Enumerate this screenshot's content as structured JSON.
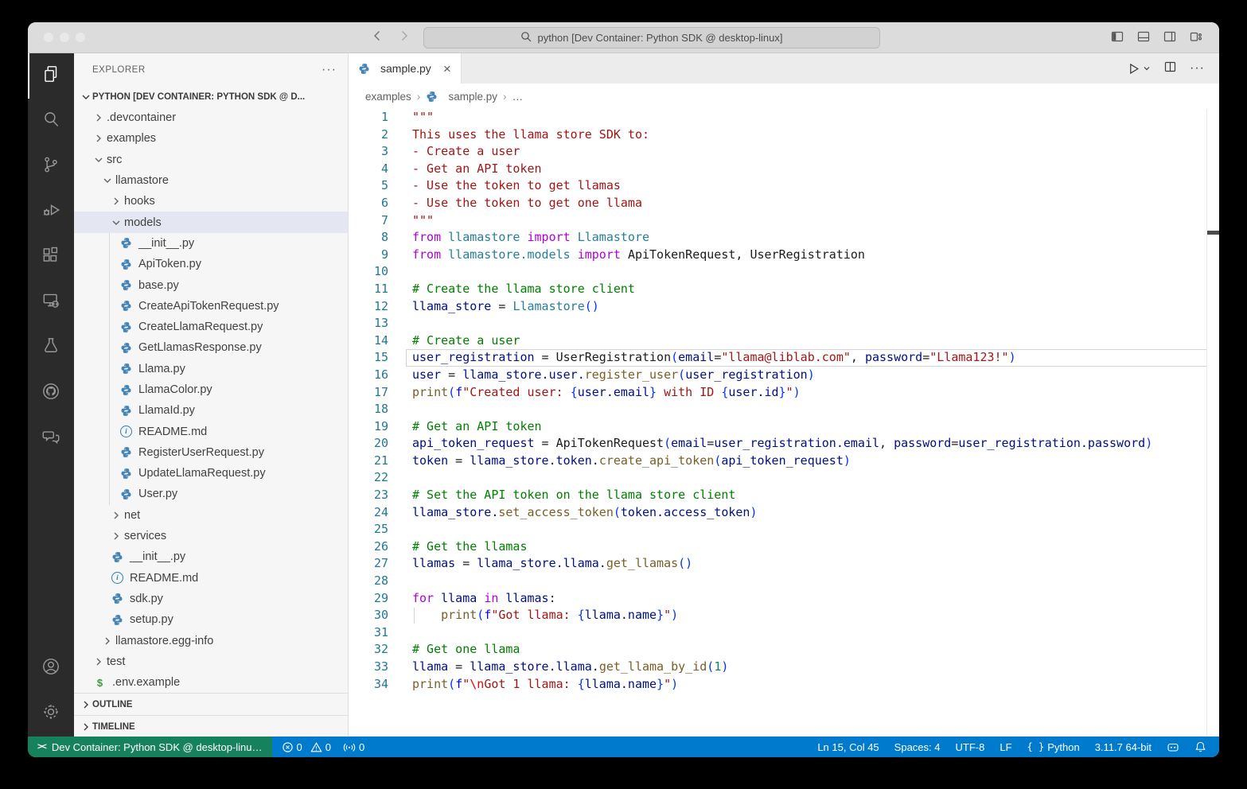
{
  "title_bar": {
    "command_center": "python [Dev Container: Python SDK @ desktop-linux]"
  },
  "activity_bar": {
    "items": [
      "explorer",
      "search",
      "source-control",
      "run-debug",
      "extensions",
      "remote-explorer",
      "testing",
      "github",
      "comments"
    ],
    "bottom": [
      "accounts",
      "settings"
    ]
  },
  "sidebar": {
    "header": "EXPLORER",
    "root_label": "PYTHON [DEV CONTAINER: PYTHON SDK @ D...",
    "tree": [
      {
        "label": ".devcontainer",
        "level": 1,
        "kind": "folder"
      },
      {
        "label": "examples",
        "level": 1,
        "kind": "folder"
      },
      {
        "label": "src",
        "level": 1,
        "kind": "folder",
        "expanded": true
      },
      {
        "label": "llamastore",
        "level": 2,
        "kind": "folder",
        "expanded": true
      },
      {
        "label": "hooks",
        "level": 3,
        "kind": "folder"
      },
      {
        "label": "models",
        "level": 3,
        "kind": "folder",
        "expanded": true,
        "selected": true
      },
      {
        "label": "__init__.py",
        "level": 4,
        "kind": "file",
        "icon": "python",
        "guide": true
      },
      {
        "label": "ApiToken.py",
        "level": 4,
        "kind": "file",
        "icon": "python",
        "guide": true
      },
      {
        "label": "base.py",
        "level": 4,
        "kind": "file",
        "icon": "python",
        "guide": true
      },
      {
        "label": "CreateApiTokenRequest.py",
        "level": 4,
        "kind": "file",
        "icon": "python",
        "guide": true
      },
      {
        "label": "CreateLlamaRequest.py",
        "level": 4,
        "kind": "file",
        "icon": "python",
        "guide": true
      },
      {
        "label": "GetLlamasResponse.py",
        "level": 4,
        "kind": "file",
        "icon": "python",
        "guide": true
      },
      {
        "label": "Llama.py",
        "level": 4,
        "kind": "file",
        "icon": "python",
        "guide": true
      },
      {
        "label": "LlamaColor.py",
        "level": 4,
        "kind": "file",
        "icon": "python",
        "guide": true
      },
      {
        "label": "LlamaId.py",
        "level": 4,
        "kind": "file",
        "icon": "python",
        "guide": true
      },
      {
        "label": "README.md",
        "level": 4,
        "kind": "file",
        "icon": "info",
        "guide": true
      },
      {
        "label": "RegisterUserRequest.py",
        "level": 4,
        "kind": "file",
        "icon": "python",
        "guide": true
      },
      {
        "label": "UpdateLlamaRequest.py",
        "level": 4,
        "kind": "file",
        "icon": "python",
        "guide": true
      },
      {
        "label": "User.py",
        "level": 4,
        "kind": "file",
        "icon": "python",
        "guide": true
      },
      {
        "label": "net",
        "level": 3,
        "kind": "folder"
      },
      {
        "label": "services",
        "level": 3,
        "kind": "folder"
      },
      {
        "label": "__init__.py",
        "level": 3,
        "kind": "file",
        "icon": "python"
      },
      {
        "label": "README.md",
        "level": 3,
        "kind": "file",
        "icon": "info"
      },
      {
        "label": "sdk.py",
        "level": 3,
        "kind": "file",
        "icon": "python"
      },
      {
        "label": "setup.py",
        "level": 3,
        "kind": "file",
        "icon": "python"
      },
      {
        "label": "llamastore.egg-info",
        "level": 2,
        "kind": "folder"
      },
      {
        "label": "test",
        "level": 1,
        "kind": "folder"
      },
      {
        "label": ".env.example",
        "level": 1,
        "kind": "file",
        "icon": "env"
      }
    ],
    "bottom_panels": [
      "OUTLINE",
      "TIMELINE"
    ]
  },
  "editor": {
    "tab": "sample.py",
    "breadcrumbs": [
      "examples",
      "sample.py",
      "…"
    ],
    "current_line": 15,
    "lines": [
      {
        "n": 1,
        "t": [
          [
            "s",
            "\"\"\""
          ]
        ]
      },
      {
        "n": 2,
        "t": [
          [
            "s",
            "This uses the llama store SDK to:"
          ]
        ]
      },
      {
        "n": 3,
        "t": [
          [
            "s",
            "- Create a user"
          ]
        ]
      },
      {
        "n": 4,
        "t": [
          [
            "s",
            "- Get an API token"
          ]
        ]
      },
      {
        "n": 5,
        "t": [
          [
            "s",
            "- Use the token to get llamas"
          ]
        ]
      },
      {
        "n": 6,
        "t": [
          [
            "s",
            "- Use the token to get one llama"
          ]
        ]
      },
      {
        "n": 7,
        "t": [
          [
            "s",
            "\"\"\""
          ]
        ]
      },
      {
        "n": 8,
        "t": [
          [
            "k",
            "from"
          ],
          [
            "p",
            " "
          ],
          [
            "c",
            "llamastore"
          ],
          [
            "p",
            " "
          ],
          [
            "k",
            "import"
          ],
          [
            "p",
            " "
          ],
          [
            "c",
            "Llamastore"
          ]
        ]
      },
      {
        "n": 9,
        "t": [
          [
            "k",
            "from"
          ],
          [
            "p",
            " "
          ],
          [
            "c",
            "llamastore.models"
          ],
          [
            "p",
            " "
          ],
          [
            "k",
            "import"
          ],
          [
            "p",
            " "
          ],
          [
            "p",
            "ApiTokenRequest, UserRegistration"
          ]
        ]
      },
      {
        "n": 10,
        "t": []
      },
      {
        "n": 11,
        "t": [
          [
            "m",
            "# Create the llama store client"
          ]
        ]
      },
      {
        "n": 12,
        "t": [
          [
            "v",
            "llama_store"
          ],
          [
            "p",
            " = "
          ],
          [
            "c",
            "Llamastore"
          ],
          [
            "b",
            "()"
          ]
        ]
      },
      {
        "n": 13,
        "t": []
      },
      {
        "n": 14,
        "t": [
          [
            "m",
            "# Create a user"
          ]
        ]
      },
      {
        "n": 15,
        "t": [
          [
            "v",
            "user_registration"
          ],
          [
            "p",
            " = "
          ],
          [
            "p",
            "UserRegistration"
          ],
          [
            "b",
            "("
          ],
          [
            "v",
            "email"
          ],
          [
            "p",
            "="
          ],
          [
            "s",
            "\"llama@liblab.com\""
          ],
          [
            "p",
            ", "
          ],
          [
            "v",
            "password"
          ],
          [
            "p",
            "="
          ],
          [
            "s",
            "\"Llama123!\""
          ],
          [
            "b",
            ")"
          ]
        ]
      },
      {
        "n": 16,
        "t": [
          [
            "v",
            "user"
          ],
          [
            "p",
            " = "
          ],
          [
            "v",
            "llama_store.user."
          ],
          [
            "f",
            "register_user"
          ],
          [
            "b",
            "("
          ],
          [
            "v",
            "user_registration"
          ],
          [
            "b",
            ")"
          ]
        ]
      },
      {
        "n": 17,
        "t": [
          [
            "f",
            "print"
          ],
          [
            "b",
            "("
          ],
          [
            "F",
            "f"
          ],
          [
            "s",
            "\"Created user: "
          ],
          [
            "b",
            "{"
          ],
          [
            "v",
            "user.email"
          ],
          [
            "b",
            "}"
          ],
          [
            "s",
            " with ID "
          ],
          [
            "b",
            "{"
          ],
          [
            "v",
            "user.id"
          ],
          [
            "b",
            "}"
          ],
          [
            "s",
            "\""
          ],
          [
            "b",
            ")"
          ]
        ]
      },
      {
        "n": 18,
        "t": []
      },
      {
        "n": 19,
        "t": [
          [
            "m",
            "# Get an API token"
          ]
        ]
      },
      {
        "n": 20,
        "t": [
          [
            "v",
            "api_token_request"
          ],
          [
            "p",
            " = "
          ],
          [
            "p",
            "ApiTokenRequest"
          ],
          [
            "b",
            "("
          ],
          [
            "v",
            "email"
          ],
          [
            "p",
            "="
          ],
          [
            "v",
            "user_registration.email"
          ],
          [
            "p",
            ", "
          ],
          [
            "v",
            "password"
          ],
          [
            "p",
            "="
          ],
          [
            "v",
            "user_registration.password"
          ],
          [
            "b",
            ")"
          ]
        ]
      },
      {
        "n": 21,
        "t": [
          [
            "v",
            "token"
          ],
          [
            "p",
            " = "
          ],
          [
            "v",
            "llama_store.token."
          ],
          [
            "f",
            "create_api_token"
          ],
          [
            "b",
            "("
          ],
          [
            "v",
            "api_token_request"
          ],
          [
            "b",
            ")"
          ]
        ]
      },
      {
        "n": 22,
        "t": []
      },
      {
        "n": 23,
        "t": [
          [
            "m",
            "# Set the API token on the llama store client"
          ]
        ]
      },
      {
        "n": 24,
        "t": [
          [
            "v",
            "llama_store."
          ],
          [
            "f",
            "set_access_token"
          ],
          [
            "b",
            "("
          ],
          [
            "v",
            "token.access_token"
          ],
          [
            "b",
            ")"
          ]
        ]
      },
      {
        "n": 25,
        "t": []
      },
      {
        "n": 26,
        "t": [
          [
            "m",
            "# Get the llamas"
          ]
        ]
      },
      {
        "n": 27,
        "t": [
          [
            "v",
            "llamas"
          ],
          [
            "p",
            " = "
          ],
          [
            "v",
            "llama_store.llama."
          ],
          [
            "f",
            "get_llamas"
          ],
          [
            "b",
            "()"
          ]
        ]
      },
      {
        "n": 28,
        "t": []
      },
      {
        "n": 29,
        "t": [
          [
            "k",
            "for"
          ],
          [
            "p",
            " "
          ],
          [
            "v",
            "llama"
          ],
          [
            "p",
            " "
          ],
          [
            "k",
            "in"
          ],
          [
            "p",
            " "
          ],
          [
            "v",
            "llamas"
          ],
          [
            "p",
            ":"
          ]
        ]
      },
      {
        "n": 30,
        "g": true,
        "t": [
          [
            "p",
            "    "
          ],
          [
            "f",
            "print"
          ],
          [
            "b",
            "("
          ],
          [
            "F",
            "f"
          ],
          [
            "s",
            "\"Got llama: "
          ],
          [
            "b",
            "{"
          ],
          [
            "v",
            "llama.name"
          ],
          [
            "b",
            "}"
          ],
          [
            "s",
            "\""
          ],
          [
            "b",
            ")"
          ]
        ]
      },
      {
        "n": 31,
        "t": []
      },
      {
        "n": 32,
        "t": [
          [
            "m",
            "# Get one llama"
          ]
        ]
      },
      {
        "n": 33,
        "t": [
          [
            "v",
            "llama"
          ],
          [
            "p",
            " = "
          ],
          [
            "v",
            "llama_store.llama."
          ],
          [
            "f",
            "get_llama_by_id"
          ],
          [
            "b",
            "("
          ],
          [
            "n",
            "1"
          ],
          [
            "b",
            ")"
          ]
        ]
      },
      {
        "n": 34,
        "t": [
          [
            "f",
            "print"
          ],
          [
            "b",
            "("
          ],
          [
            "F",
            "f"
          ],
          [
            "s",
            "\""
          ],
          [
            "e",
            "\\n"
          ],
          [
            "s",
            "Got 1 llama: "
          ],
          [
            "b",
            "{"
          ],
          [
            "v",
            "llama.name"
          ],
          [
            "b",
            "}"
          ],
          [
            "s",
            "\""
          ],
          [
            "b",
            ")"
          ]
        ]
      }
    ]
  },
  "status_bar": {
    "remote": "Dev Container: Python SDK @ desktop-linu…",
    "errors": "0",
    "warnings": "0",
    "ports": "0",
    "cursor": "Ln 15, Col 45",
    "indent": "Spaces: 4",
    "encoding": "UTF-8",
    "eol": "LF",
    "language": "Python",
    "interpreter": "3.11.7 64-bit"
  },
  "colors": {
    "status_blue": "#007acc",
    "remote_green": "#16825d",
    "list_selection": "#e4e6f1",
    "activity_bar": "#2b2b2b",
    "token": {
      "keyword": "#af00db",
      "class": "#267f99",
      "variable": "#001080",
      "function": "#795e26",
      "string": "#a31515",
      "comment": "#008000",
      "number": "#098658",
      "bracket": "#0431fa",
      "line_number": "#237893"
    }
  }
}
